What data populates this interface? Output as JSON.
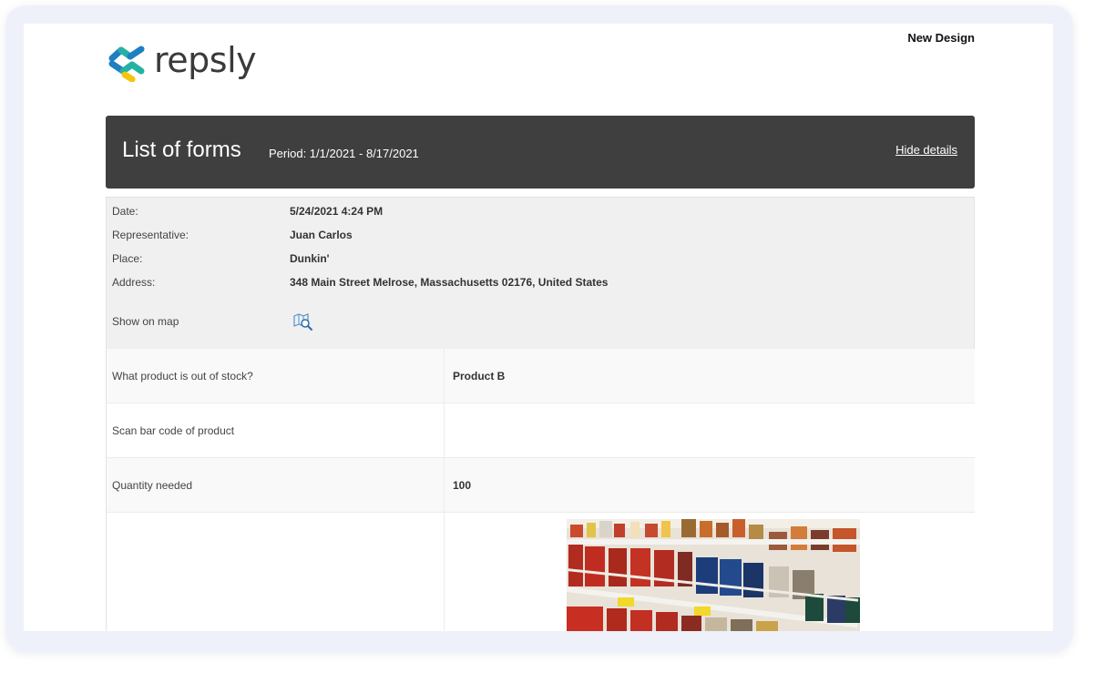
{
  "brand": {
    "name": "repsly",
    "colors": {
      "blue": "#1e7fc2",
      "teal": "#24b2a4",
      "yellow": "#f5c40f"
    }
  },
  "top_right_label": "New Design",
  "header": {
    "title": "List of forms",
    "period": "Period: 1/1/2021 - 8/17/2021",
    "hide_details": "Hide details"
  },
  "details": {
    "date": {
      "label": "Date:",
      "value": "5/24/2021 4:24 PM"
    },
    "representative": {
      "label": "Representative:",
      "value": "Juan Carlos"
    },
    "place": {
      "label": "Place:",
      "value": "Dunkin'"
    },
    "address": {
      "label": "Address:",
      "value": "348 Main Street Melrose, Massachusetts 02176, United States"
    },
    "show_on_map": {
      "label": "Show on map",
      "icon": "map-search-icon"
    }
  },
  "questions": [
    {
      "question": "What product is out of stock?",
      "answer": "Product B"
    },
    {
      "question": "Scan bar code of product",
      "answer": ""
    },
    {
      "question": "Quantity needed",
      "answer": "100"
    }
  ],
  "photo": {
    "description_icon": "product-shelf-photo"
  }
}
